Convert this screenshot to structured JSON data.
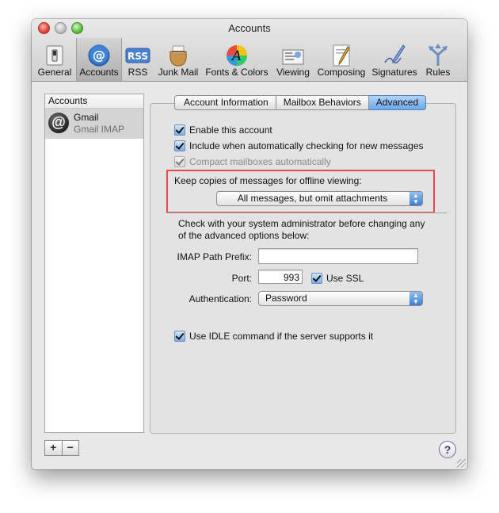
{
  "window": {
    "title": "Accounts"
  },
  "toolbar": {
    "items": [
      {
        "label": "General",
        "icon": "switch-icon"
      },
      {
        "label": "Accounts",
        "icon": "at-sign-icon"
      },
      {
        "label": "RSS",
        "icon": "rss-icon",
        "icon_text": "RSS"
      },
      {
        "label": "Junk Mail",
        "icon": "junk-bag-icon"
      },
      {
        "label": "Fonts & Colors",
        "icon": "fonts-colors-icon",
        "icon_text": "A"
      },
      {
        "label": "Viewing",
        "icon": "viewing-icon"
      },
      {
        "label": "Composing",
        "icon": "composing-icon"
      },
      {
        "label": "Signatures",
        "icon": "signatures-icon"
      },
      {
        "label": "Rules",
        "icon": "rules-icon"
      }
    ],
    "selected": "Accounts"
  },
  "sidebar": {
    "header": "Accounts",
    "accounts": [
      {
        "name": "Gmail",
        "type": "Gmail IMAP",
        "icon_text": "@"
      }
    ],
    "add_label": "+",
    "remove_label": "−"
  },
  "tabs": {
    "items": [
      "Account Information",
      "Mailbox Behaviors",
      "Advanced"
    ],
    "active": "Advanced"
  },
  "advanced": {
    "enable_account": {
      "label": "Enable this account",
      "checked": true
    },
    "include_checking": {
      "label": "Include when automatically checking for new messages",
      "checked": true
    },
    "compact_mailboxes": {
      "label": "Compact mailboxes automatically",
      "checked": true,
      "disabled": true
    },
    "offline_label": "Keep copies of messages for offline viewing:",
    "offline_value": "All messages, but omit attachments",
    "admin_note": "Check with your system administrator before changing any of the advanced options below:",
    "imap_prefix_label": "IMAP Path Prefix:",
    "imap_prefix_value": "",
    "port_label": "Port:",
    "port_value": "993",
    "use_ssl": {
      "label": "Use SSL",
      "checked": true
    },
    "auth_label": "Authentication:",
    "auth_value": "Password",
    "idle": {
      "label": "Use IDLE command if the server supports it",
      "checked": true
    }
  },
  "help_label": "?",
  "colors": {
    "highlight": "#e3494d",
    "selected_tab": "#6ea8ea",
    "checkbox": "#78aee9"
  }
}
